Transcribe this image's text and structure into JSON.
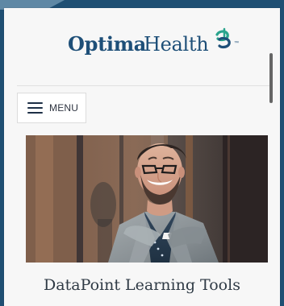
{
  "brand": {
    "logo_primary": "Optima",
    "logo_secondary": "Health",
    "trademark": "™",
    "mark_icon": "optima-health-logo-icon",
    "colors": {
      "brand_blue": "#1e4f78",
      "brand_teal": "#2aa48d",
      "frame_blue": "#1f4f73"
    }
  },
  "navigation": {
    "menu_label": "MENU",
    "menu_icon": "hamburger-menu-icon"
  },
  "hero": {
    "title": "DataPoint Learning Tools"
  }
}
